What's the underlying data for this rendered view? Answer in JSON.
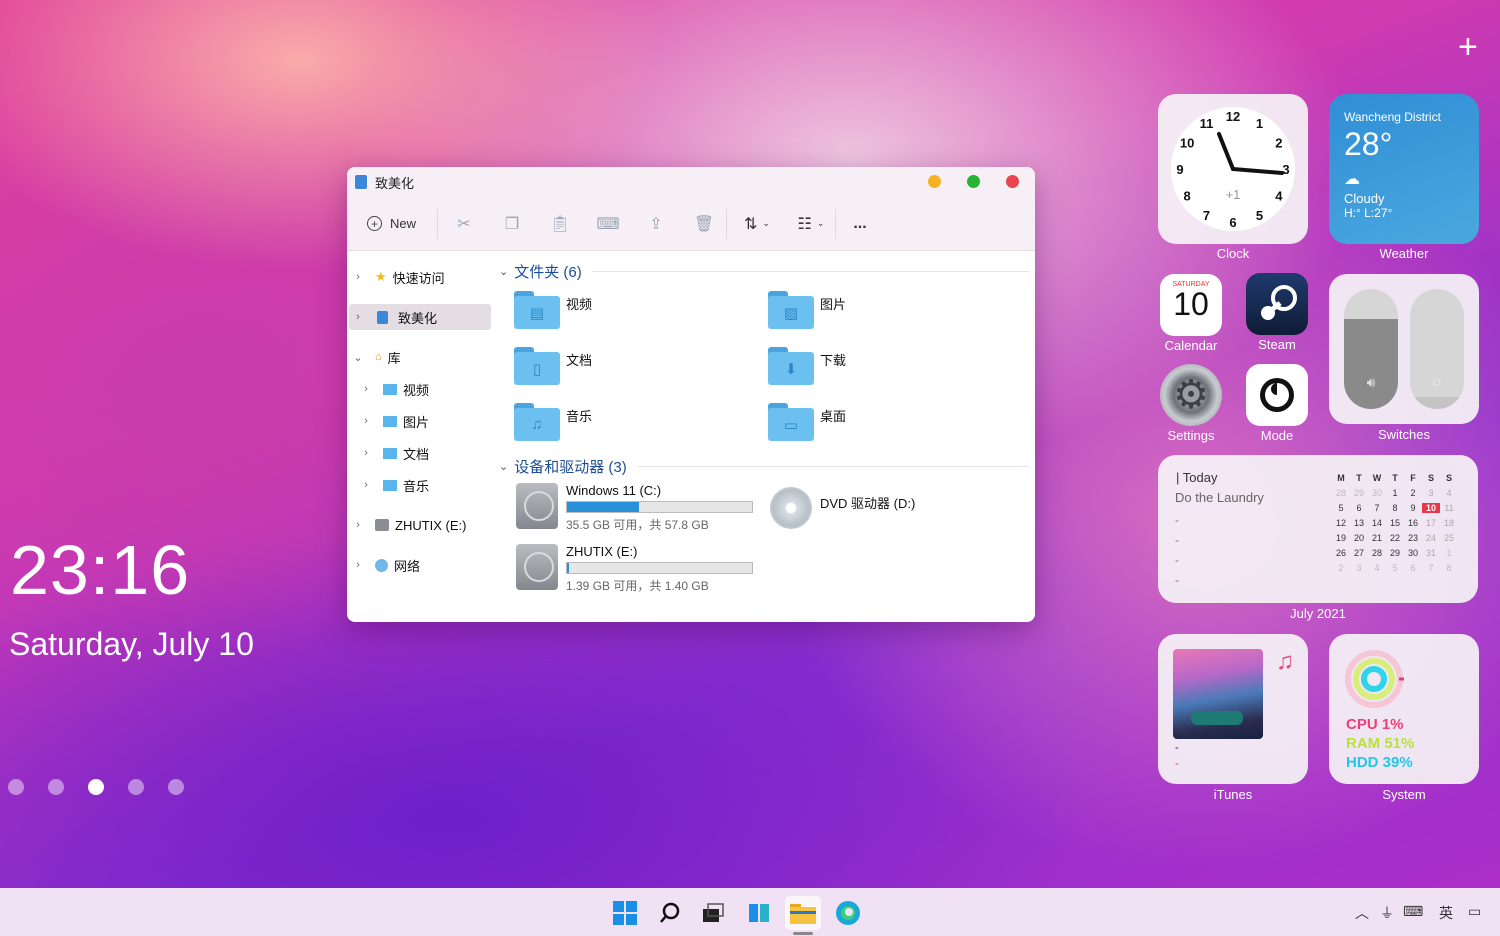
{
  "desktop": {
    "time": "23:16",
    "date": "Saturday, July 10",
    "plus": "+"
  },
  "explorer": {
    "title": "致美化",
    "toolbar": {
      "new": "New",
      "more": "..."
    },
    "sidebar": [
      {
        "label": "快速访问"
      },
      {
        "label": "致美化"
      },
      {
        "label": "库"
      },
      {
        "label": "视频"
      },
      {
        "label": "图片"
      },
      {
        "label": "文档"
      },
      {
        "label": "音乐"
      },
      {
        "label": "ZHUTIX (E:)"
      },
      {
        "label": "网络"
      }
    ],
    "folders_header": "文件夹 (6)",
    "folders": [
      "视频",
      "图片",
      "文档",
      "下载",
      "音乐",
      "桌面"
    ],
    "drives_header": "设备和驱动器 (3)",
    "drives": [
      {
        "name": "Windows 11 (C:)",
        "info": "35.5 GB 可用，共 57.8 GB",
        "used": 0.39
      },
      {
        "name": "DVD 驱动器 (D:)"
      },
      {
        "name": "ZHUTIX (E:)",
        "info": "1.39 GB 可用，共 1.40 GB",
        "used": 0.01
      }
    ],
    "colors": {
      "close": "#e8464e",
      "max": "#28b334",
      "min": "#f6b223"
    }
  },
  "widgets": {
    "clock": {
      "label": "Clock",
      "numbers": [
        "12",
        "1",
        "2",
        "3",
        "4",
        "5",
        "6",
        "7",
        "8",
        "9",
        "10",
        "11"
      ],
      "offset": "+1"
    },
    "weather": {
      "label": "Weather",
      "location": "Wancheng District",
      "temp": "28°",
      "condition": "Cloudy",
      "range": "H:° L:27°"
    },
    "calendar": {
      "label": "Calendar",
      "weekday": "SATURDAY",
      "day": "10"
    },
    "steam": {
      "label": "Steam"
    },
    "settings": {
      "label": "Settings"
    },
    "mode": {
      "label": "Mode"
    },
    "switches": {
      "label": "Switches",
      "volume": 0.75,
      "brightness": 0.1
    },
    "today": {
      "label": "July 2021",
      "heading": "| Today",
      "task": "Do the Laundry",
      "placeholders": [
        "-",
        "-",
        "-",
        "-"
      ],
      "weekdays": [
        "M",
        "T",
        "W",
        "T",
        "F",
        "S",
        "S"
      ],
      "days": [
        "28",
        "29",
        "30",
        "1",
        "2",
        "3",
        "4",
        "5",
        "6",
        "7",
        "8",
        "9",
        "10",
        "11",
        "12",
        "13",
        "14",
        "15",
        "16",
        "17",
        "18",
        "19",
        "20",
        "21",
        "22",
        "23",
        "24",
        "25",
        "26",
        "27",
        "28",
        "29",
        "30",
        "31",
        "1",
        "2",
        "3",
        "4",
        "5",
        "6",
        "7",
        "8"
      ]
    },
    "itunes": {
      "label": "iTunes",
      "line1": "-",
      "line2": "-"
    },
    "system": {
      "label": "System",
      "cpu": "CPU 1%",
      "ram": "RAM 51%",
      "hdd": "HDD 39%"
    }
  },
  "taskbar": {
    "ime": "英"
  }
}
